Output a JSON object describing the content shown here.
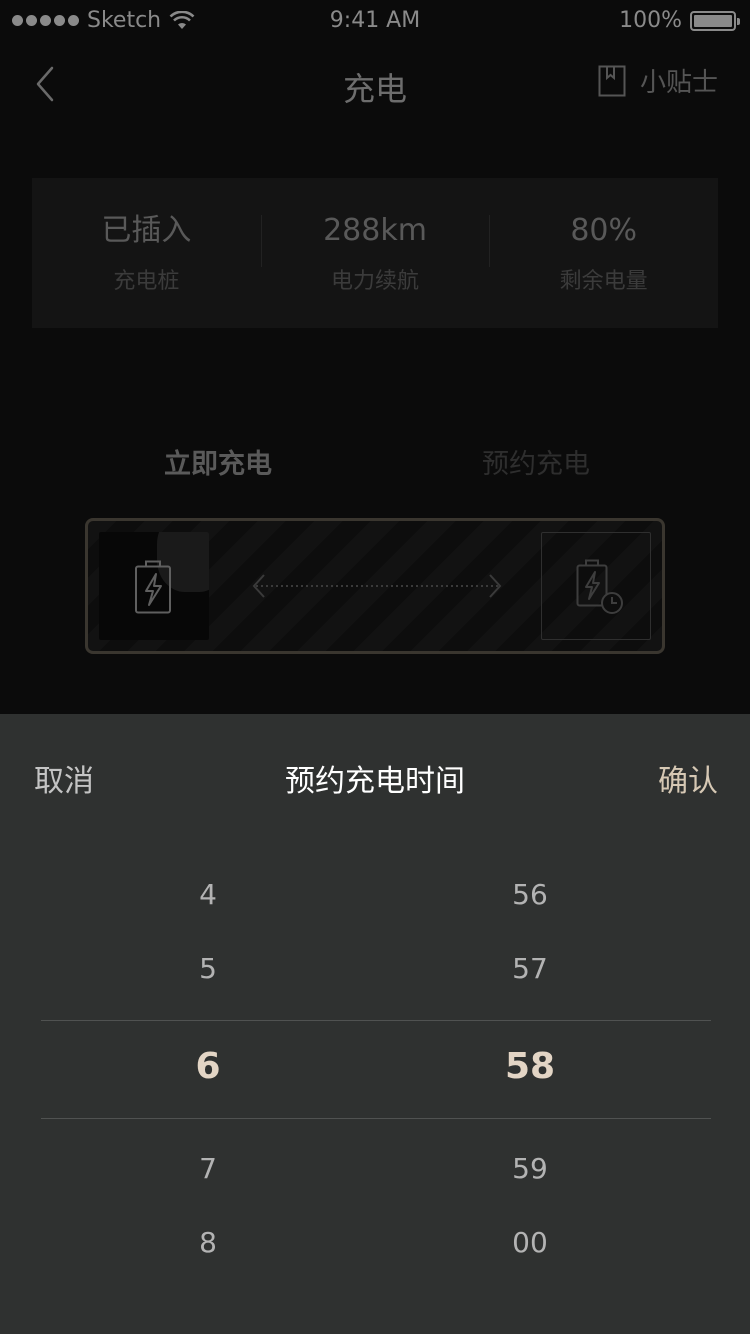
{
  "status_bar": {
    "carrier": "Sketch",
    "time": "9:41 AM",
    "battery": "100%",
    "battery_level": 1.0
  },
  "nav": {
    "title": "充电",
    "tips_label": "小贴士"
  },
  "stats": [
    {
      "value": "已插入",
      "label": "充电桩"
    },
    {
      "value": "288km",
      "label": "电力续航"
    },
    {
      "value": "80%",
      "label": "剩余电量"
    }
  ],
  "modes": {
    "now": "立即充电",
    "scheduled": "预约充电"
  },
  "picker": {
    "cancel": "取消",
    "title": "预约充电时间",
    "confirm": "确认",
    "hours": [
      "4",
      "5",
      "6",
      "7",
      "8"
    ],
    "minutes": [
      "56",
      "57",
      "58",
      "59",
      "00"
    ],
    "selected_hour": "6",
    "selected_minute": "58"
  },
  "colors": {
    "background": "#0b0b0b",
    "sheet": "#2f3130",
    "accent": "#d6c8b4",
    "selected": "#e3d5c5"
  }
}
